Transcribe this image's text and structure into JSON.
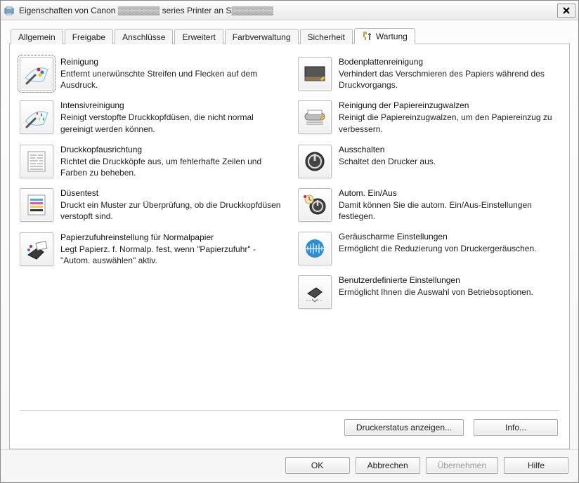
{
  "window": {
    "title": "Eigenschaften von Canon ▒▒▒▒▒▒▒ series Printer an S▒▒▒▒▒▒▒",
    "close": "✕"
  },
  "tabs": [
    {
      "label": "Allgemein"
    },
    {
      "label": "Freigabe"
    },
    {
      "label": "Anschlüsse"
    },
    {
      "label": "Erweitert"
    },
    {
      "label": "Farbverwaltung"
    },
    {
      "label": "Sicherheit"
    },
    {
      "label": "Wartung",
      "active": true
    }
  ],
  "left": [
    {
      "icon": "wipe-drops",
      "title": "Reinigung",
      "desc": "Entfernt unerwünschte Streifen und Flecken auf dem Ausdruck.",
      "selected": true
    },
    {
      "icon": "wipe-drops-strong",
      "title": "Intensivreinigung",
      "desc": "Reinigt verstopfte Druckkopfdüsen, die nicht normal gereinigt werden können."
    },
    {
      "icon": "align-head",
      "title": "Druckkopfausrichtung",
      "desc": "Richtet die Druckköpfe aus, um fehlerhafte Zeilen und Farben zu beheben."
    },
    {
      "icon": "nozzle-test",
      "title": "Düsentest",
      "desc": "Druckt ein Muster zur Überprüfung, ob die Druckkopfdüsen verstopft sind."
    },
    {
      "icon": "paper-feed",
      "title": "Papierzufuhreinstellung für Normalpapier",
      "desc": "Legt Papierz. f. Normalp. fest, wenn \"Papierzufuhr\" - \"Autom. auswählen\" aktiv."
    }
  ],
  "right": [
    {
      "icon": "bottom-plate",
      "title": "Bodenplattenreinigung",
      "desc": "Verhindert das Verschmieren des Papiers während des Druckvorgangs."
    },
    {
      "icon": "roller-clean",
      "title": "Reinigung der Papiereinzugwalzen",
      "desc": "Reinigt die Papiereinzugwalzen, um den Papiereinzug zu verbessern."
    },
    {
      "icon": "power-off",
      "title": "Ausschalten",
      "desc": "Schaltet den Drucker aus."
    },
    {
      "icon": "auto-power",
      "title": "Autom. Ein/Aus",
      "desc": "Damit können Sie die autom. Ein/Aus-Einstellungen festlegen."
    },
    {
      "icon": "quiet",
      "title": "Geräuscharme Einstellungen",
      "desc": "Ermöglicht die Reduzierung von Druckergeräuschen."
    },
    {
      "icon": "custom-settings",
      "title": "Benutzerdefinierte Einstellungen",
      "desc": "Ermöglicht Ihnen die Auswahl von Betriebsoptionen."
    }
  ],
  "bottom": {
    "status": "Druckerstatus anzeigen...",
    "info": "Info..."
  },
  "buttons": {
    "ok": "OK",
    "cancel": "Abbrechen",
    "apply": "Übernehmen",
    "help": "Hilfe"
  }
}
